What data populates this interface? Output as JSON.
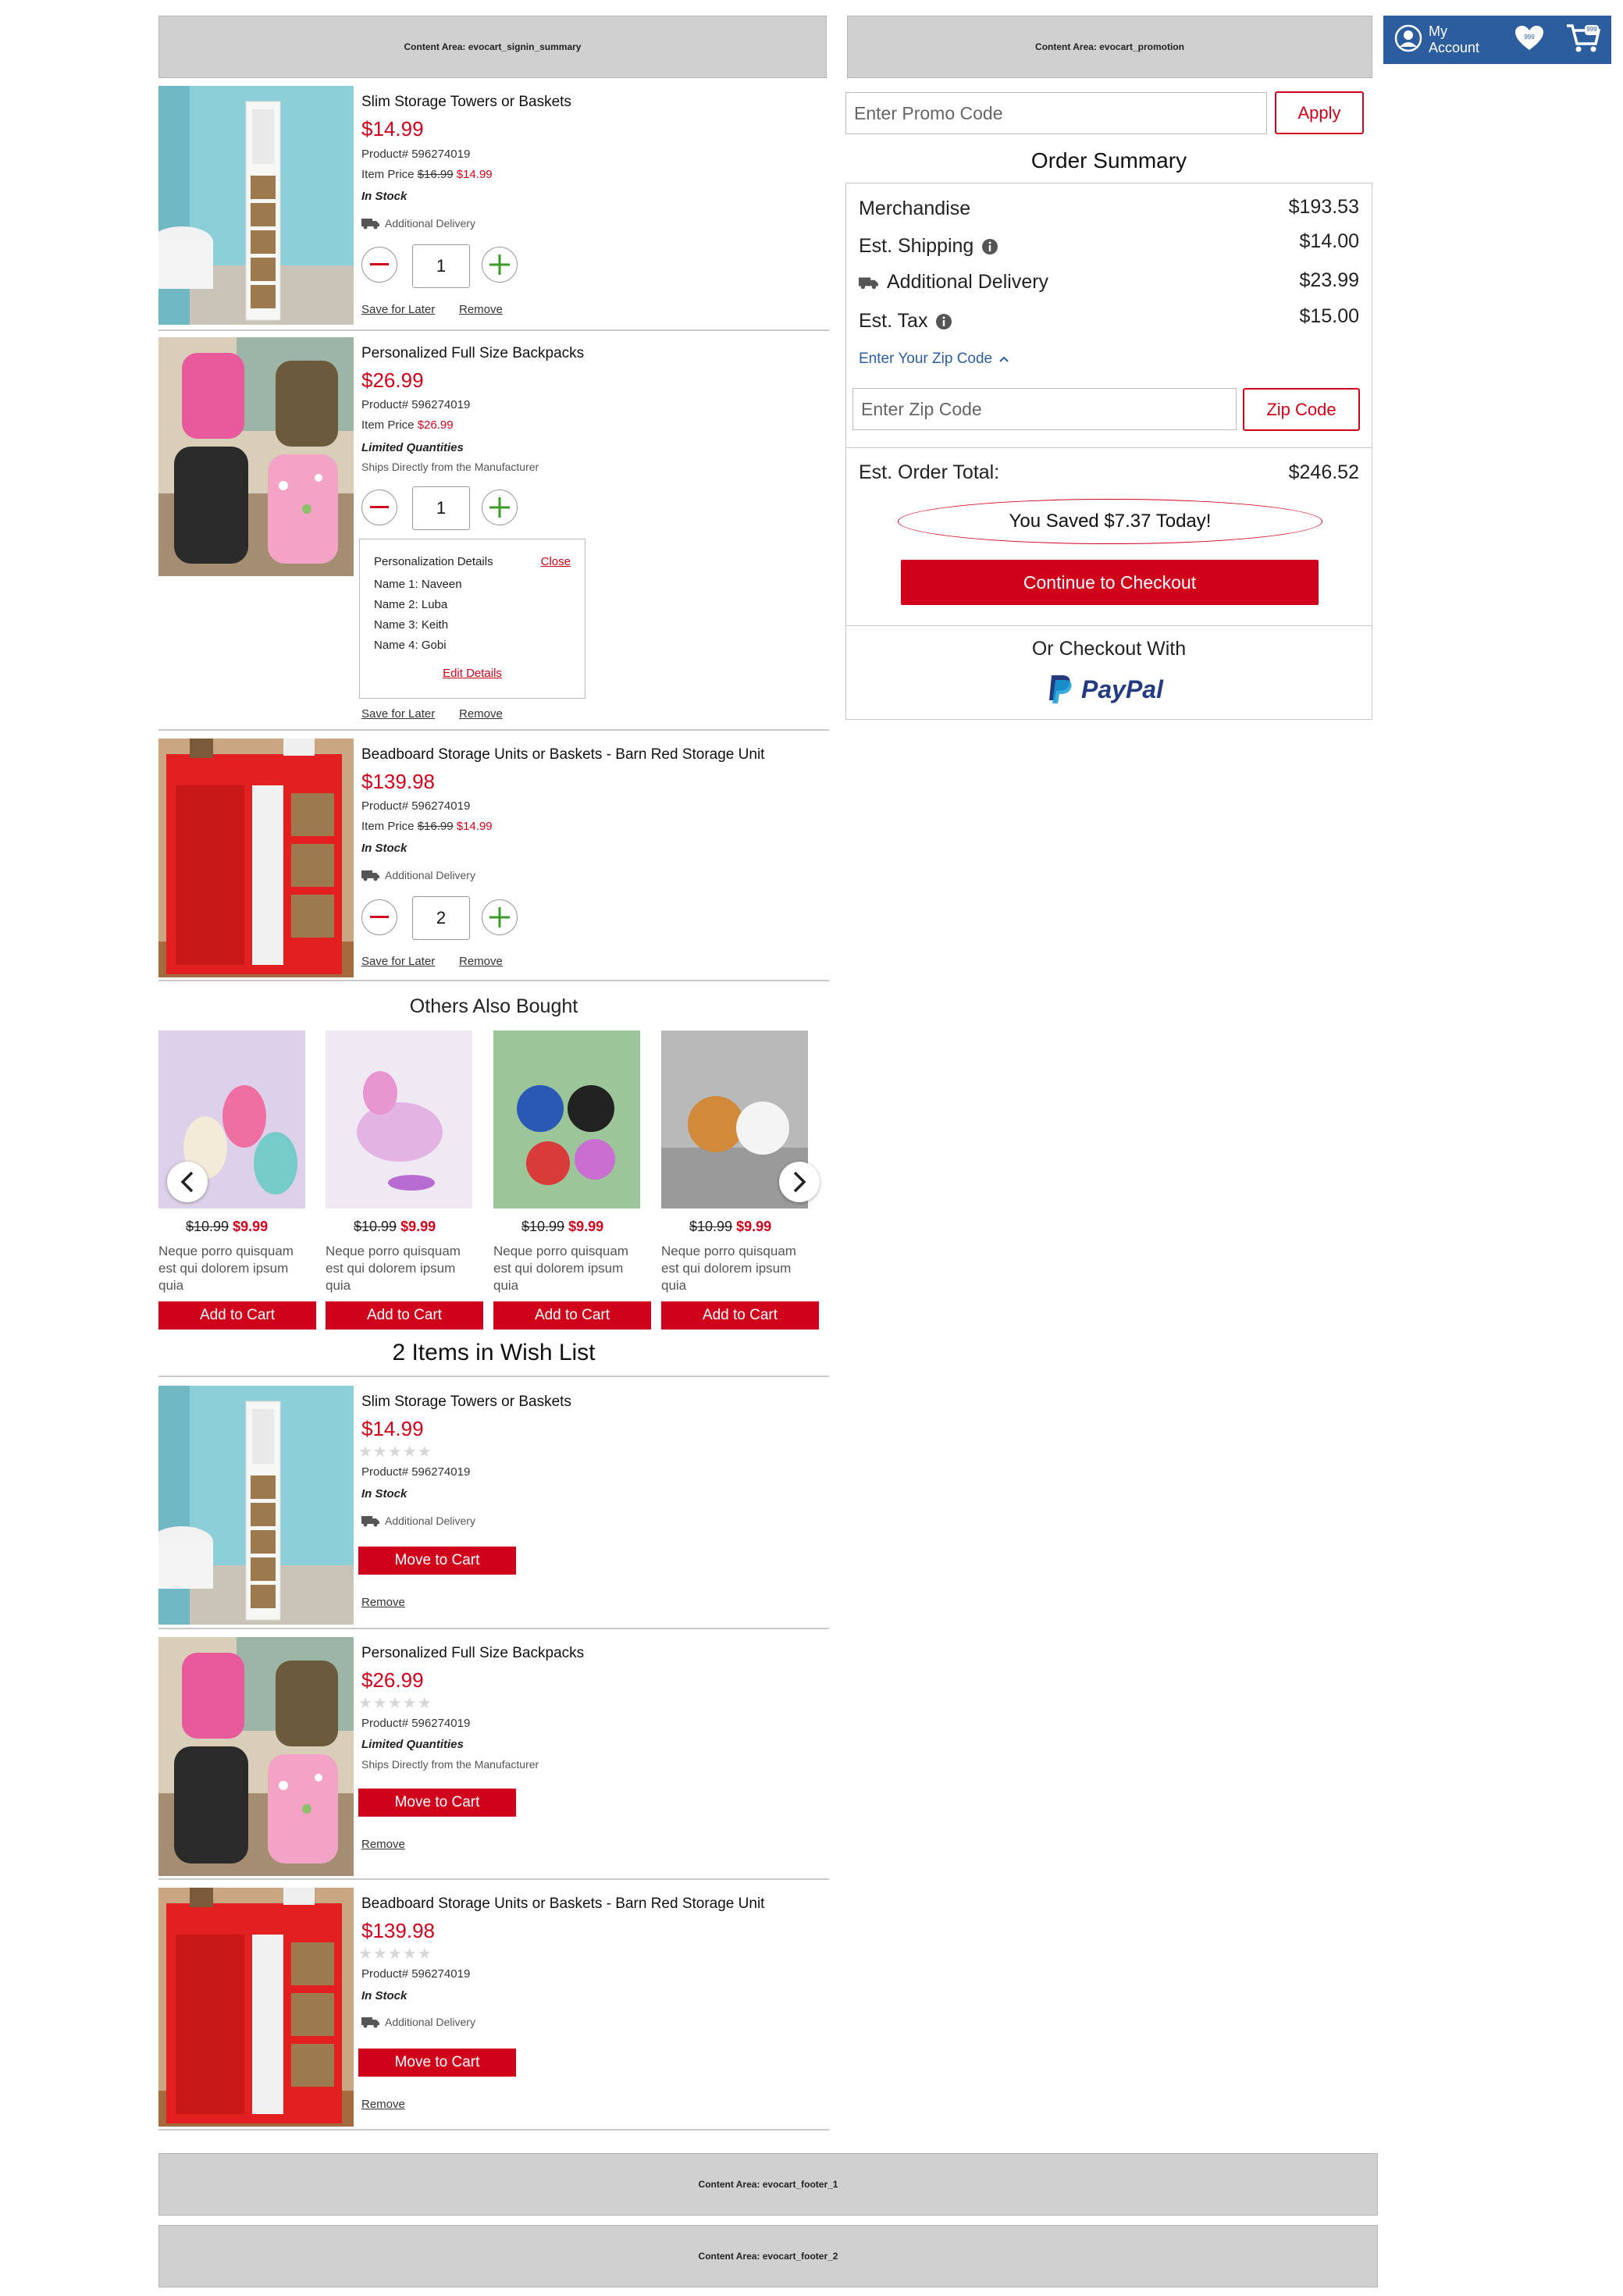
{
  "content_areas": {
    "signin_summary": "Content Area: evocart_signin_summary",
    "promotion": "Content Area: evocart_promotion",
    "footer_1": "Content Area: evocart_footer_1",
    "footer_2": "Content Area: evocart_footer_2"
  },
  "header": {
    "account_label": "My Account",
    "wishlist_count": "999",
    "cart_count": "999",
    "bg_color": "#2c5d9f"
  },
  "promo": {
    "placeholder": "Enter Promo Code",
    "apply_label": "Apply"
  },
  "summary": {
    "title": "Order Summary",
    "merch_label": "Merchandise",
    "merch_value": "$193.53",
    "ship_label": "Est. Shipping",
    "ship_value": "$14.00",
    "delivery_label": "Additional Delivery",
    "delivery_value": "$23.99",
    "tax_label": "Est. Tax",
    "tax_value": "$15.00",
    "zip_link": "Enter Your Zip Code",
    "zip_placeholder": "Enter Zip Code",
    "zip_button": "Zip Code",
    "total_label": "Est. Order Total:",
    "total_value": "$246.52",
    "saved_text": "You Saved $7.37 Today!",
    "checkout_label": "Continue to Checkout",
    "alt_checkout_label": "Or Checkout With",
    "paypal_label": "PayPal"
  },
  "cart_items": [
    {
      "title": "Slim Storage Towers or Baskets",
      "price": "$14.99",
      "product": "Product# 596274019",
      "item_price_label": "Item Price",
      "item_price_old": "$16.99",
      "item_price_new": "$14.99",
      "status": "In Stock",
      "delivery": "Additional Delivery",
      "qty": "1",
      "save_label": "Save for Later",
      "remove_label": "Remove"
    },
    {
      "title": "Personalized Full Size Backpacks",
      "price": "$26.99",
      "product": "Product# 596274019",
      "item_price_label": "Item Price",
      "item_price_new": "$26.99",
      "status": "Limited Quantities",
      "ships_note": "Ships Directly from the Manufacturer",
      "qty": "1",
      "personalization": {
        "heading": "Personalization Details",
        "close": "Close",
        "names": [
          "Name 1: Naveen",
          "Name 2: Luba",
          "Name 3: Keith",
          "Name 4: Gobi"
        ],
        "edit": "Edit Details"
      },
      "save_label": "Save for Later",
      "remove_label": "Remove"
    },
    {
      "title": "Beadboard Storage Units or Baskets - Barn Red Storage Unit",
      "price": "$139.98",
      "product": "Product# 596274019",
      "item_price_label": "Item Price",
      "item_price_old": "$16.99",
      "item_price_new": "$14.99",
      "status": "In Stock",
      "delivery": "Additional Delivery",
      "qty": "2",
      "save_label": "Save for Later",
      "remove_label": "Remove"
    }
  ],
  "recommendations": {
    "title": "Others Also Bought",
    "items": [
      {
        "old": "$10.99",
        "new": "$9.99",
        "desc": "Neque porro quisquam est qui dolorem ipsum quia",
        "button": "Add to Cart"
      },
      {
        "old": "$10.99",
        "new": "$9.99",
        "desc": "Neque porro quisquam est qui dolorem ipsum quia",
        "button": "Add to Cart"
      },
      {
        "old": "$10.99",
        "new": "$9.99",
        "desc": "Neque porro quisquam est qui dolorem ipsum quia",
        "button": "Add to Cart"
      },
      {
        "old": "$10.99",
        "new": "$9.99",
        "desc": "Neque porro quisquam est qui dolorem ipsum quia",
        "button": "Add to Cart"
      }
    ]
  },
  "wishlist": {
    "title": "2 Items in Wish List",
    "items": [
      {
        "title": "Slim Storage Towers or Baskets",
        "price": "$14.99",
        "product": "Product# 596274019",
        "status": "In Stock",
        "delivery": "Additional Delivery",
        "move_label": "Move to Cart",
        "remove_label": "Remove"
      },
      {
        "title": "Personalized Full Size Backpacks",
        "price": "$26.99",
        "product": "Product# 596274019",
        "status": "Limited Quantities",
        "ships_note": "Ships Directly from the Manufacturer",
        "move_label": "Move to Cart",
        "remove_label": "Remove"
      },
      {
        "title": "Beadboard Storage Units or Baskets - Barn Red Storage Unit",
        "price": "$139.98",
        "product": "Product# 596274019",
        "status": "In Stock",
        "delivery": "Additional Delivery",
        "move_label": "Move to Cart",
        "remove_label": "Remove"
      }
    ]
  },
  "colors": {
    "accent_red": "#d0021b",
    "header_blue": "#2c5d9f",
    "link_blue": "#2c5d9f"
  }
}
